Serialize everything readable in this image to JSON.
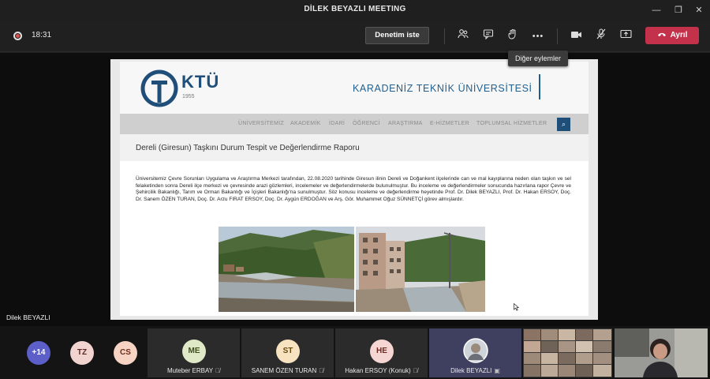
{
  "window": {
    "title": "DİLEK BEYAZLI MEETING",
    "minimize": "—",
    "maximize": "❐",
    "close": "✕"
  },
  "toolbar": {
    "timer": "18:31",
    "request_control": "Denetim iste",
    "leave_label": "Ayrıl",
    "leave_color": "#c4314b",
    "icons": [
      "participants-icon",
      "chat-icon",
      "raise-hand-icon",
      "more-actions-icon",
      "camera-icon",
      "mic-off-icon",
      "share-icon"
    ],
    "more_actions_glyph": "•••"
  },
  "tooltip": {
    "text": "Diğer eylemler"
  },
  "shared_screen": {
    "presenter_label": "Dilek BEYAZLI",
    "site": {
      "logo_text": "KTÜ",
      "logo_year": "1955",
      "university_name": "KARADENİZ TEKNİK ÜNİVERSİTESİ",
      "nav": [
        "ÜNİVERSİTEMİZ",
        "AKADEMİK",
        "İDARİ",
        "ÖĞRENCİ",
        "ARAŞTIRMA",
        "E-HİZMETLER",
        "TOPLUMSAL HİZMETLER"
      ],
      "search_glyph": "⌕",
      "article_title": "Dereli (Giresun) Taşkını Durum Tespit ve Değerlendirme Raporu",
      "article_body": "Üniversitemiz Çevre Sorunları Uygulama ve Araştırma Merkezi tarafından, 22.08.2020 tarihinde Giresun ilinin Dereli ve Doğankent ilçelerinde can ve mal kayıplarına neden olan taşkın ve sel felaketinden sonra Dereli ilçe merkezi ve çevresinde arazi gözlemleri, incelemeler ve değerlendirmelerde bulunulmuştur. Bu inceleme ve değerlendirmeler sonucunda hazırlana rapor Çevre ve Şehircilik Bakanlığı, Tarım ve Orman Bakanlığı ve İçişleri Bakanlığı'na sunulmuştur. Söz konusu inceleme ve değerlendirme heyetinde Prof. Dr. Dilek BEYAZLI, Prof. Dr. Hakan ERSOY, Doç. Dr. Sanem ÖZEN TURAN, Doç. Dr. Arzu FIRAT ERSOY, Doç. Dr. Aygün ERDOĞAN ve Arş. Gör. Muhammet Oğuz SÜNNETÇİ görev almışlardır."
    }
  },
  "participants": {
    "overflow_count": "+14",
    "mini_avatars": [
      {
        "initials": "TZ",
        "bg": "#f1d3cf",
        "fg": "#5a2a22"
      },
      {
        "initials": "CS",
        "bg": "#f6d3c2",
        "fg": "#6b2e1a"
      }
    ],
    "overflow_bg": "#5b5fc7",
    "tiles": [
      {
        "initials": "ME",
        "name": "Muteber ERBAY",
        "bg": "#dfe9c8",
        "fg": "#3d4f1a"
      },
      {
        "initials": "ST",
        "name": "SANEM ÖZEN TURAN",
        "bg": "#f7e3c0",
        "fg": "#6b4a10"
      },
      {
        "initials": "HE",
        "name": "Hakan ERSOY (Konuk)",
        "bg": "#f6d6d2",
        "fg": "#6b2a22"
      }
    ],
    "active_tile": {
      "name": "Dilek BEYAZLI"
    }
  }
}
